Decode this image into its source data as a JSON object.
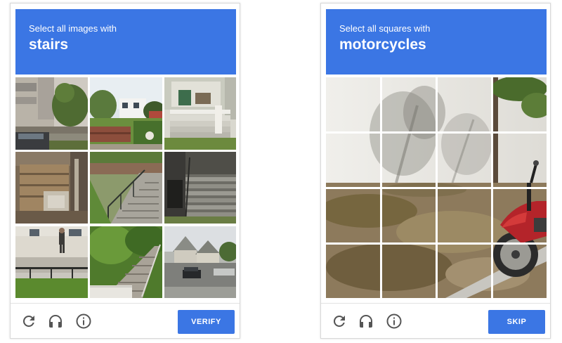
{
  "left": {
    "instruction": "Select all images with",
    "target": "stairs",
    "button": "VERIFY",
    "icons": [
      "reload-icon",
      "headphones-icon",
      "info-icon"
    ]
  },
  "right": {
    "instruction": "Select all squares with",
    "target": "motorcycles",
    "button": "SKIP",
    "icons": [
      "reload-icon",
      "headphones-icon",
      "info-icon"
    ]
  },
  "colors": {
    "accent": "#3b76e4",
    "header_text": "#ffffff",
    "icon": "#555555"
  }
}
